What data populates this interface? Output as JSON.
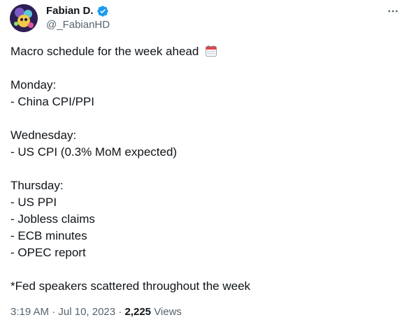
{
  "author": {
    "display_name": "Fabian D.",
    "handle": "@_FabianHD",
    "verified_badge_icon": "verified-badge-icon",
    "verified_color": "#1d9bf0",
    "avatar_icon": "avatar-image"
  },
  "more_icon": "more-horizontal-icon",
  "tweet": {
    "headline": "Macro schedule for the week ahead",
    "headline_emoji_icon": "calendar-icon",
    "monday_label": "Monday:",
    "monday_items": [
      "- China CPI/PPI"
    ],
    "wednesday_label": "Wednesday:",
    "wednesday_items": [
      "- US CPI (0.3% MoM expected)"
    ],
    "thursday_label": "Thursday:",
    "thursday_items": [
      "- US PPI",
      "- Jobless claims",
      "- ECB minutes",
      "- OPEC report"
    ],
    "footnote": "*Fed speakers scattered throughout the week"
  },
  "meta": {
    "time": "3:19 AM",
    "separator": "·",
    "date": "Jul 10, 2023",
    "views_count": "2,225",
    "views_label": "Views"
  },
  "colors": {
    "text_primary": "#0f1419",
    "text_secondary": "#536471",
    "accent": "#1d9bf0"
  }
}
